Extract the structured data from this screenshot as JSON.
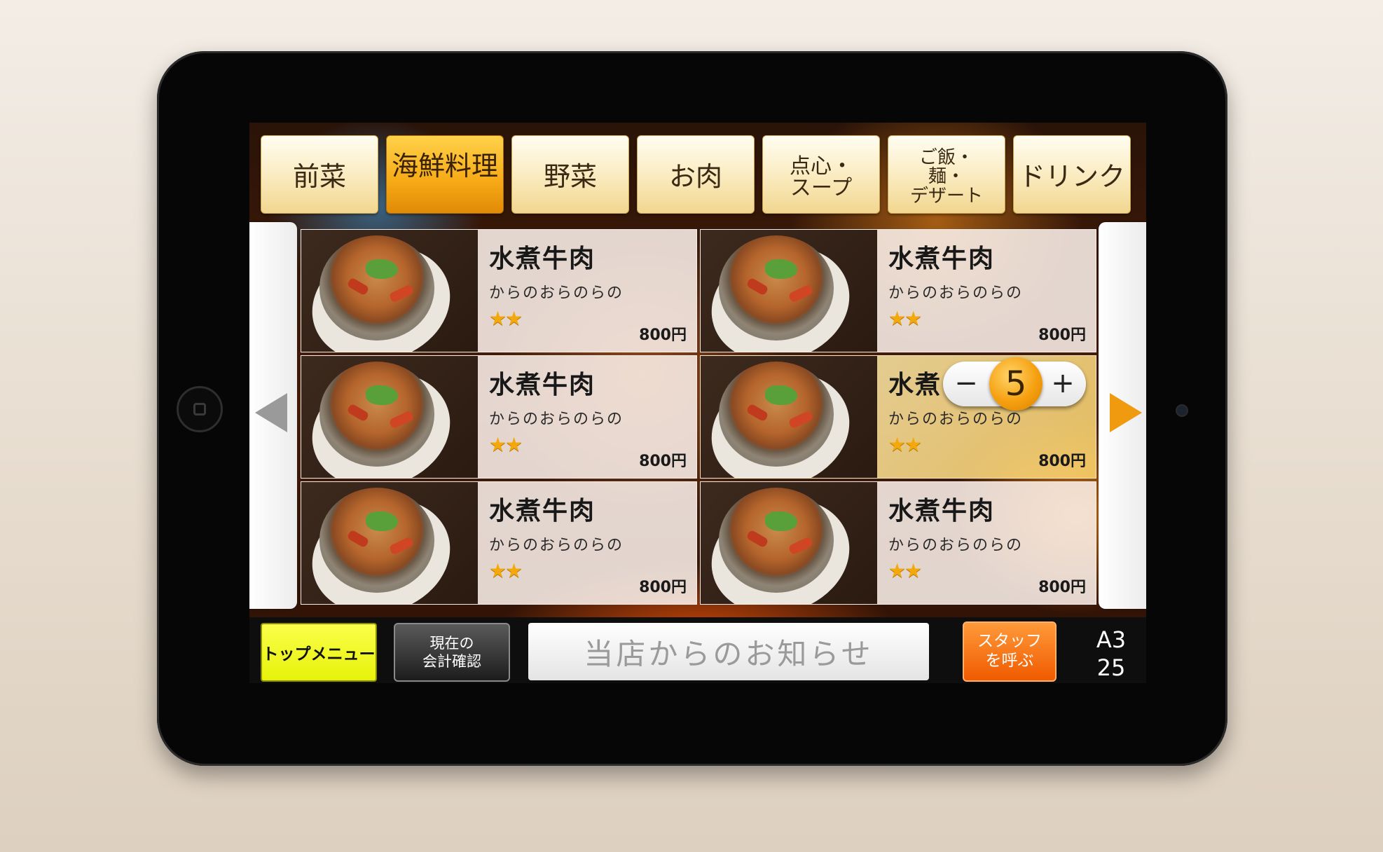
{
  "categories": [
    {
      "label": "前菜",
      "active": false
    },
    {
      "label": "海鮮料理",
      "active": true
    },
    {
      "label": "野菜",
      "active": false
    },
    {
      "label": "お肉",
      "active": false
    },
    {
      "label": "点心・\nスープ",
      "active": false
    },
    {
      "label": "ご飯・\n麺・\nデザート",
      "active": false
    },
    {
      "label": "ドリンク",
      "active": false
    }
  ],
  "menu_items": [
    {
      "name": "水煮牛肉",
      "description": "からのおらのらの",
      "stars": "★★",
      "price": "800円"
    },
    {
      "name": "水煮牛肉",
      "description": "からのおらのらの",
      "stars": "★★",
      "price": "800円"
    },
    {
      "name": "水煮牛肉",
      "description": "からのおらのらの",
      "stars": "★★",
      "price": "800円"
    },
    {
      "name": "水煮",
      "description": "からのおらのらの",
      "stars": "★★",
      "price": "800円",
      "quantity": "5"
    },
    {
      "name": "水煮牛肉",
      "description": "からのおらのらの",
      "stars": "★★",
      "price": "800円"
    },
    {
      "name": "水煮牛肉",
      "description": "からのおらのらの",
      "stars": "★★",
      "price": "800円"
    }
  ],
  "stepper": {
    "minus": "−",
    "plus": "+"
  },
  "bottom": {
    "top_menu": "トップメニュー",
    "account_line1": "現在の",
    "account_line2": "会計確認",
    "notice": "当店からのお知らせ",
    "staff_line1": "スタッフ",
    "staff_line2": "を呼ぶ",
    "table_id": "A3",
    "table_count": "25"
  },
  "colors": {
    "accent": "#f6a915",
    "staff": "#f05a00",
    "top_menu": "#e6f20a"
  }
}
